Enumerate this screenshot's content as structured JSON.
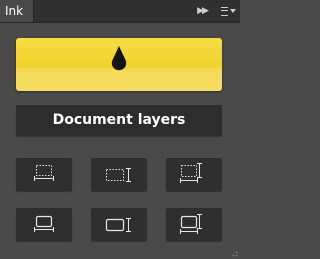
{
  "panel": {
    "tab_title": "Ink",
    "collapse_glyph": "▶▶"
  },
  "ink": {
    "icon": "ink-drop-icon",
    "accent_color": "#f2d22b"
  },
  "document_layers": {
    "label": "Document layers"
  },
  "layout_buttons": [
    {
      "name": "layout-dashed-top-baseline",
      "icon": "dashed-frame-baseline-icon"
    },
    {
      "name": "layout-dashed-cursor",
      "icon": "dashed-frame-cursor-icon"
    },
    {
      "name": "layout-dashed-corner-cursor",
      "icon": "dashed-frame-corner-cursor-icon"
    },
    {
      "name": "layout-solid-baseline",
      "icon": "solid-frame-baseline-icon"
    },
    {
      "name": "layout-solid-cursor",
      "icon": "solid-frame-cursor-icon"
    },
    {
      "name": "layout-solid-corner-cursor",
      "icon": "solid-frame-corner-cursor-icon"
    }
  ]
}
